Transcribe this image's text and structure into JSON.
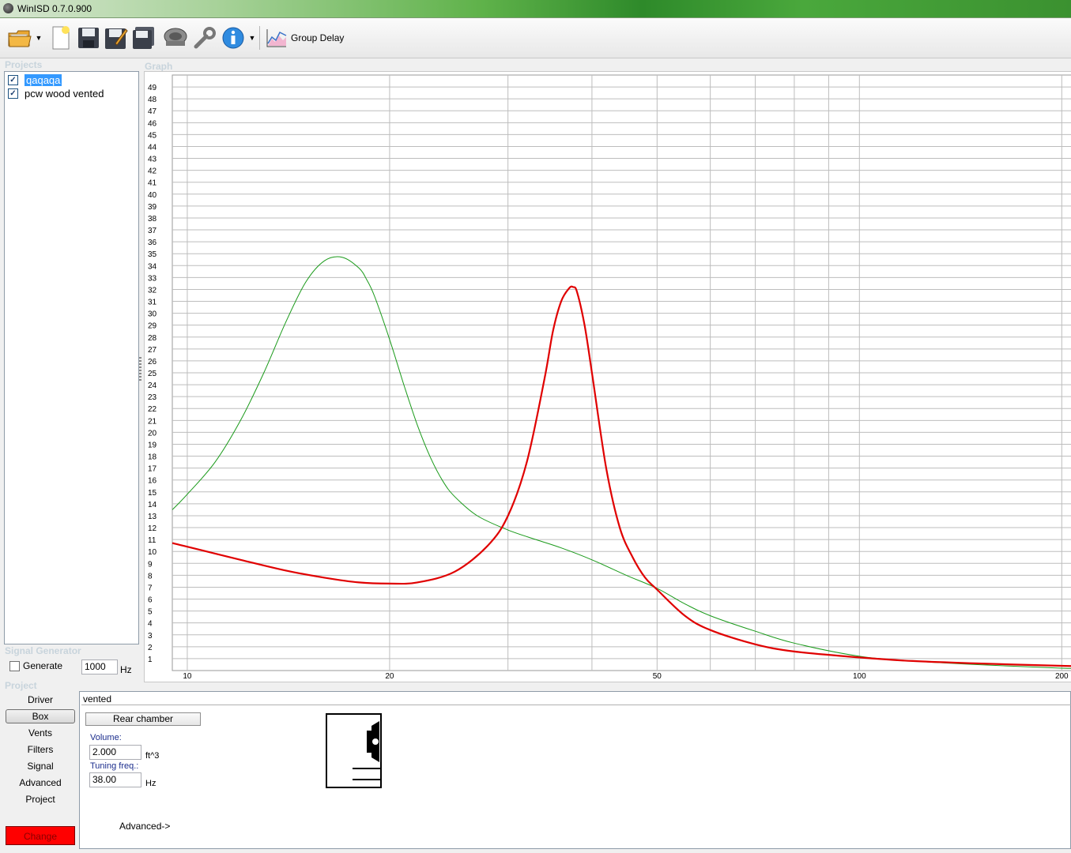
{
  "window": {
    "title": "WinISD 0.7.0.900"
  },
  "toolbar": {
    "buttons": [
      {
        "name": "open-folder-icon"
      },
      {
        "name": "new-document-icon"
      },
      {
        "name": "save-icon"
      },
      {
        "name": "save-as-icon"
      },
      {
        "name": "save-all-icon"
      },
      {
        "name": "driver-icon"
      },
      {
        "name": "wrench-icon"
      },
      {
        "name": "info-icon"
      }
    ],
    "graph_selector_label": "Group Delay"
  },
  "projects": {
    "header": "Projects",
    "items": [
      {
        "label": "qaqaqa",
        "checked": true,
        "selected": true
      },
      {
        "label": "pcw wood vented",
        "checked": true,
        "selected": false
      }
    ]
  },
  "graph": {
    "header": "Graph"
  },
  "signal_generator": {
    "header": "Signal Generator",
    "generate_label": "Generate",
    "frequency": "1000",
    "unit": "Hz"
  },
  "project_nav": {
    "header": "Project",
    "items": [
      "Driver",
      "Box",
      "Vents",
      "Filters",
      "Signal",
      "Advanced",
      "Project"
    ],
    "active": "Box",
    "change_label": "Change"
  },
  "box": {
    "type": "vented",
    "rear_chamber_label": "Rear chamber",
    "volume_label": "Volume:",
    "volume_value": "2.000",
    "volume_unit": "ft^3",
    "tuning_label": "Tuning freq.:",
    "tuning_value": "38.00",
    "tuning_unit": "Hz",
    "advanced_link": "Advanced->"
  },
  "colors": {
    "series_red": "#e00000",
    "series_green": "#1a9a1a",
    "grid": "#bdbdbd",
    "selection": "#3399ff",
    "change_button": "#ff0000"
  },
  "chart_data": {
    "type": "line",
    "title": "",
    "xlabel": "",
    "ylabel": "",
    "x_scale": "log",
    "xlim": [
      9.5,
      207
    ],
    "ylim": [
      0,
      50
    ],
    "x_ticks": [
      10,
      20,
      50,
      100,
      200
    ],
    "y_ticks": [
      1,
      2,
      3,
      4,
      5,
      6,
      7,
      8,
      9,
      10,
      11,
      12,
      13,
      14,
      15,
      16,
      17,
      18,
      19,
      20,
      21,
      22,
      23,
      24,
      25,
      26,
      27,
      28,
      29,
      30,
      31,
      32,
      33,
      34,
      35,
      36,
      37,
      38,
      39,
      40,
      41,
      42,
      43,
      44,
      45,
      46,
      47,
      48,
      49
    ],
    "grid": true,
    "series": [
      {
        "color": "#1a9a1a",
        "x": [
          9.5,
          10,
          11,
          12,
          13,
          14,
          15,
          16,
          17,
          18,
          18.5,
          19,
          20,
          21,
          22,
          23,
          24,
          25,
          27,
          30,
          33,
          36,
          40,
          45,
          50,
          55,
          60,
          70,
          80,
          100,
          120,
          150,
          200,
          207
        ],
        "y": [
          13.5,
          14.8,
          17.5,
          21.0,
          25.0,
          29.2,
          32.6,
          34.4,
          34.7,
          33.8,
          32.8,
          31.4,
          27.8,
          24.0,
          20.6,
          17.9,
          15.9,
          14.6,
          13.0,
          11.8,
          11.0,
          10.3,
          9.3,
          8.0,
          6.9,
          5.6,
          4.6,
          3.3,
          2.3,
          1.2,
          0.8,
          0.5,
          0.2,
          0.2
        ]
      },
      {
        "color": "#e00000",
        "x": [
          9.5,
          10,
          12,
          14,
          16,
          18,
          20,
          22,
          25,
          28,
          30,
          32,
          34,
          35,
          36,
          37,
          37.5,
          38,
          39,
          40,
          42,
          44,
          46,
          48,
          50,
          55,
          60,
          70,
          80,
          100,
          120,
          150,
          200,
          207
        ],
        "y": [
          10.7,
          10.4,
          9.3,
          8.4,
          7.8,
          7.4,
          7.3,
          7.4,
          8.3,
          10.5,
          13.0,
          17.5,
          24.5,
          28.5,
          31.0,
          32.1,
          32.2,
          31.8,
          29.0,
          25.0,
          17.0,
          12.0,
          9.5,
          7.8,
          6.8,
          4.6,
          3.4,
          2.2,
          1.6,
          1.1,
          0.8,
          0.6,
          0.4,
          0.4
        ]
      }
    ]
  }
}
